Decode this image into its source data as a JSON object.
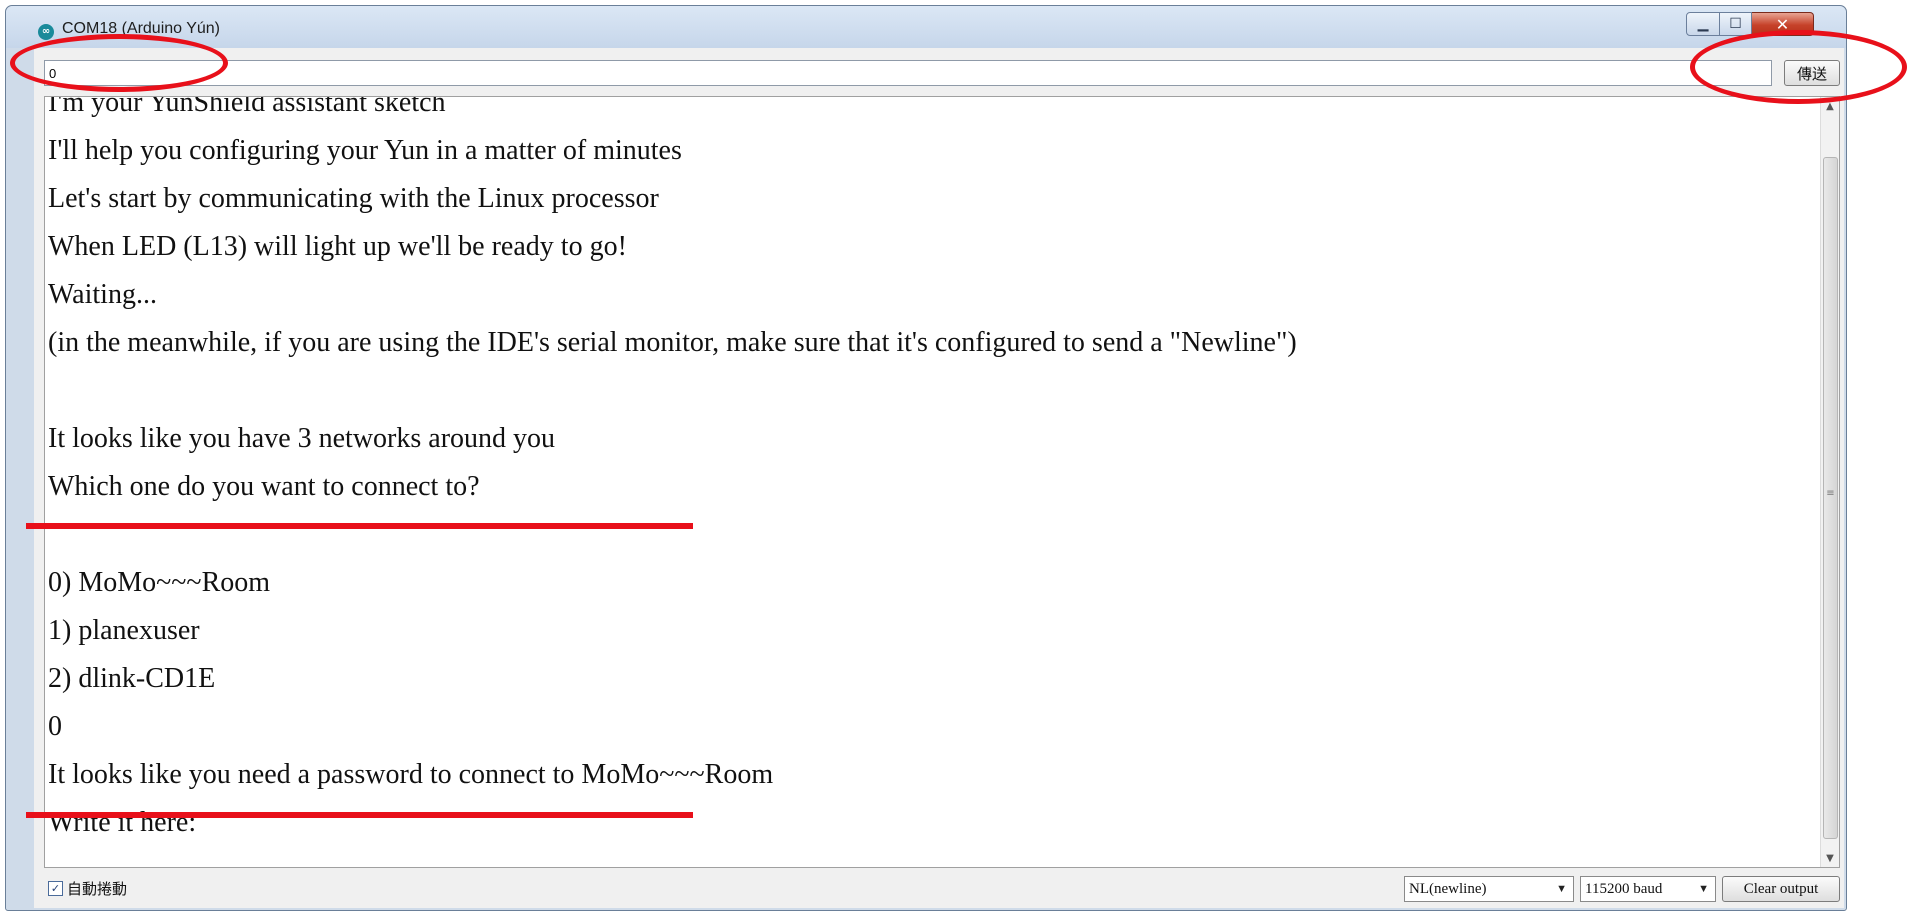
{
  "window": {
    "title": "COM18 (Arduino Yún)",
    "icon": "arduino-infinity-icon",
    "controls": {
      "minimize": "minimize-icon",
      "maximize": "maximize-icon",
      "close": "close-icon"
    }
  },
  "send_bar": {
    "input_value": "0",
    "send_label": "傳送"
  },
  "output": {
    "lines": [
      "I'm your YunShield assistant sketch",
      "I'll help you configuring your Yun in a matter of minutes",
      "Let's start by communicating with the Linux processor",
      "When LED (L13) will light up we'll be ready to go!",
      "Waiting...",
      "(in the meanwhile, if you are using the IDE's serial monitor, make sure that it's configured to send a \"Newline\")",
      "",
      "It looks like you have 3 networks around you",
      "Which one do you want to connect to?",
      "",
      "0) MoMo~~~Room",
      "1) planexuser",
      "2) dlink-CD1E",
      "0",
      "It looks like you need a password to connect to MoMo~~~Room",
      "Write it here:"
    ]
  },
  "bottom_bar": {
    "autoscroll_label": "自動捲動",
    "autoscroll_checked": true,
    "line_ending": "NL(newline)",
    "baud_rate": "115200 baud",
    "clear_label": "Clear output"
  },
  "annotation_color": "#e8101a"
}
